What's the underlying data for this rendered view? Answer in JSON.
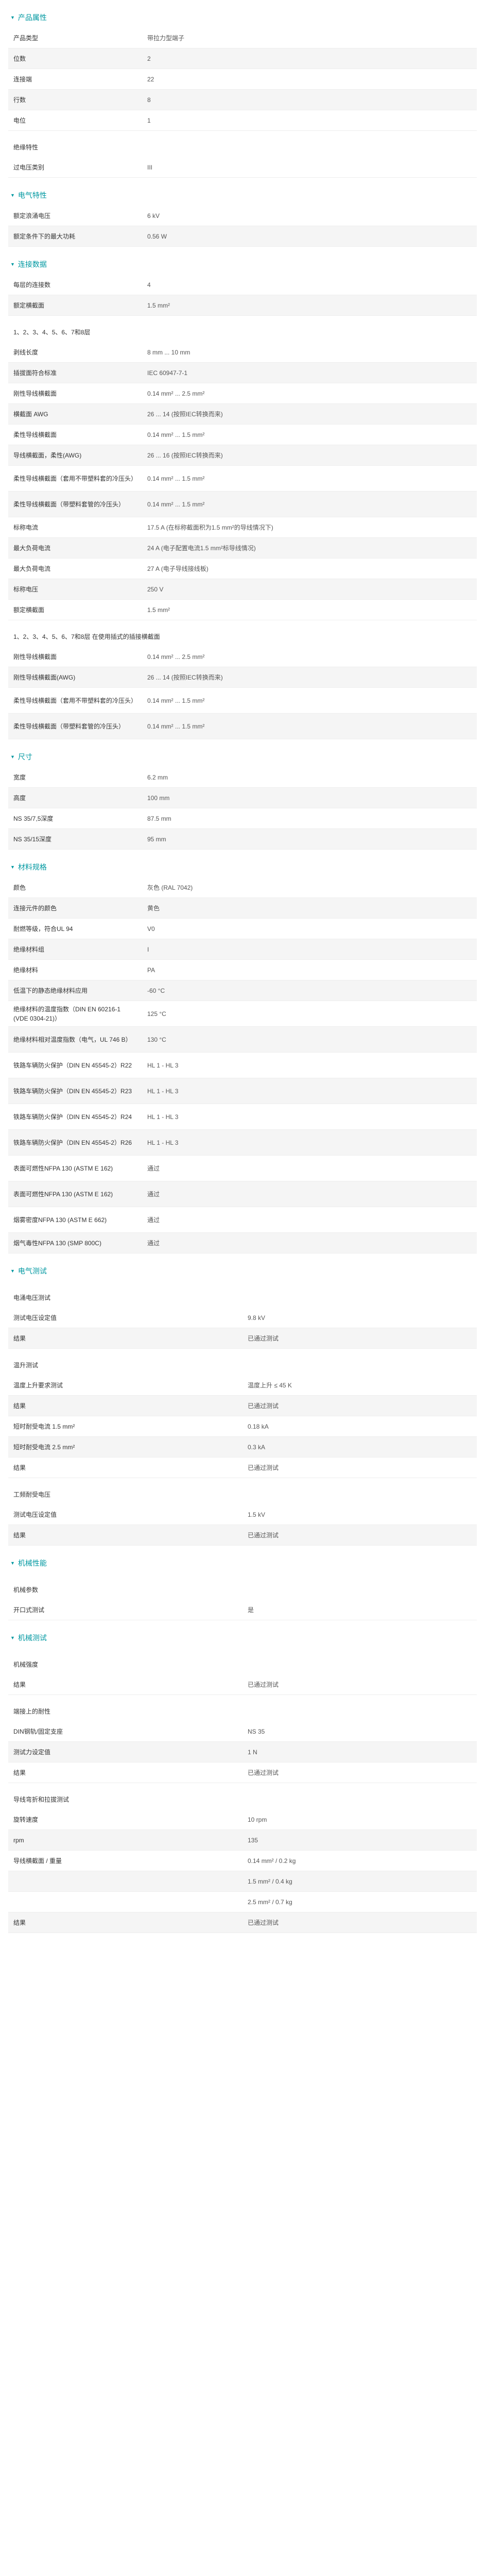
{
  "sections": [
    {
      "title": "产品属性",
      "rows": [
        {
          "k": "产品类型",
          "v": "带拉力型端子"
        },
        {
          "k": "位数",
          "v": "2"
        },
        {
          "k": "连接端",
          "v": "22"
        },
        {
          "k": "行数",
          "v": "8"
        },
        {
          "k": "电位",
          "v": "1"
        },
        {
          "sub": "绝缘特性"
        },
        {
          "k": "过电压类别",
          "v": "III"
        }
      ]
    },
    {
      "title": "电气特性",
      "rows": [
        {
          "k": "额定浪涌电压",
          "v": "6 kV"
        },
        {
          "k": "额定条件下的最大功耗",
          "v": "0.56 W"
        }
      ]
    },
    {
      "title": "连接数据",
      "rows": [
        {
          "k": "每层的连接数",
          "v": "4"
        },
        {
          "k": "额定横截面",
          "v": "1.5 mm²"
        },
        {
          "sub": "1、2、3、4、5、6、7和8层"
        },
        {
          "k": "剥线长度",
          "v": "8 mm ... 10 mm"
        },
        {
          "k": "插拔面符合标准",
          "v": "IEC 60947-7-1"
        },
        {
          "k": "刚性导线横截面",
          "v": "0.14 mm² ... 2.5 mm²"
        },
        {
          "k": "横截面 AWG",
          "v": "26 ... 14 (按照IEC转换而来)"
        },
        {
          "k": "柔性导线横截面",
          "v": "0.14 mm² ... 1.5 mm²"
        },
        {
          "k": "导线横截面，柔性(AWG)",
          "v": "26 ... 16 (按照IEC转换而来)"
        },
        {
          "k": "柔性导线横截面（套用不带塑料套的冷压头）",
          "v": "0.14 mm² ... 1.5 mm²",
          "h": "h49"
        },
        {
          "k": "柔性导线横截面（带塑料套管的冷压头）",
          "v": "0.14 mm² ... 1.5 mm²",
          "h": "h49"
        },
        {
          "k": "标称电流",
          "v": "17.5 A (在标称截面积为1.5 mm²的导线情况下)"
        },
        {
          "k": "最大负荷电流",
          "v": "24 A (电子配置电流1.5 mm²标导线情况)"
        },
        {
          "k": "最大负荷电流",
          "v": "27 A (电子导线接线板)"
        },
        {
          "k": "标称电压",
          "v": "250 V"
        },
        {
          "k": "额定横截面",
          "v": "1.5 mm²"
        },
        {
          "sub": "1、2、3、4、5、6、7和8层 在使用插式的插接横截面"
        },
        {
          "k": "刚性导线横截面",
          "v": "0.14 mm² ... 2.5 mm²"
        },
        {
          "k": "刚性导线横截面(AWG)",
          "v": "26 ... 14 (按照IEC转换而来)"
        },
        {
          "k": "柔性导线横截面（套用不带塑料套的冷压头）",
          "v": "0.14 mm² ... 1.5 mm²",
          "h": "h49"
        },
        {
          "k": "柔性导线横截面（带塑料套管的冷压头）",
          "v": "0.14 mm² ... 1.5 mm²",
          "h": "h49"
        }
      ]
    },
    {
      "title": "尺寸",
      "rows": [
        {
          "k": "宽度",
          "v": "6.2 mm"
        },
        {
          "k": "高度",
          "v": "100 mm"
        },
        {
          "k": "NS 35/7,5深度",
          "v": "87.5 mm"
        },
        {
          "k": "NS 35/15深度",
          "v": "95 mm"
        }
      ]
    },
    {
      "title": "材料规格",
      "rows": [
        {
          "k": "颜色",
          "v": "灰色 (RAL 7042)"
        },
        {
          "k": "连接元件的颜色",
          "v": "黄色"
        },
        {
          "k": "耐燃等级，符合UL 94",
          "v": "V0"
        },
        {
          "k": "绝缘材料组",
          "v": "I"
        },
        {
          "k": "绝缘材料",
          "v": "PA"
        },
        {
          "k": "低温下的静态绝缘材料应用",
          "v": "-60 °C"
        },
        {
          "k": "绝缘材料的温度指数（DIN EN 60216-1 (VDE 0304-21)）",
          "v": "125 °C",
          "h": "h49"
        },
        {
          "k": "绝缘材料相对温度指数（电气，UL 746 B）",
          "v": "130 °C",
          "h": "h49"
        },
        {
          "k": "铁路车辆防火保护（DIN EN 45545-2）R22",
          "v": "HL 1 - HL 3",
          "h": "h49"
        },
        {
          "k": "铁路车辆防火保护（DIN EN 45545-2）R23",
          "v": "HL 1 - HL 3",
          "h": "h49"
        },
        {
          "k": "铁路车辆防火保护（DIN EN 45545-2）R24",
          "v": "HL 1 - HL 3",
          "h": "h49"
        },
        {
          "k": "铁路车辆防火保护（DIN EN 45545-2）R26",
          "v": "HL 1 - HL 3",
          "h": "h49"
        },
        {
          "k": "表面可燃性NFPA 130 (ASTM E 162)",
          "v": "通过",
          "h": "h49"
        },
        {
          "k": "表面可燃性NFPA 130 (ASTM E 162)",
          "v": "通过",
          "h": "h49"
        },
        {
          "k": "烟雾密度NFPA 130 (ASTM E 662)",
          "v": "通过",
          "h": "h49"
        },
        {
          "k": "烟气毒性NFPA 130 (SMP 800C)",
          "v": "通过"
        }
      ]
    },
    {
      "title": "电气测试",
      "rows": [
        {
          "sub": "电涌电压测试"
        },
        {
          "k": "测试电压设定值",
          "v": "9.8 kV"
        },
        {
          "k": "结果",
          "v": "已通过测试"
        },
        {
          "sub": "温升测试"
        },
        {
          "k": "温度上升要求测试",
          "v": "温度上升 ≤ 45 K"
        },
        {
          "k": "结果",
          "v": "已通过测试"
        },
        {
          "k": "短时耐受电流 1.5 mm²",
          "v": "0.18 kA"
        },
        {
          "k": "短时耐受电流 2.5 mm²",
          "v": "0.3 kA"
        },
        {
          "k": "结果",
          "v": "已通过测试"
        },
        {
          "sub": "工频耐受电压"
        },
        {
          "k": "测试电压设定值",
          "v": "1.5 kV"
        },
        {
          "k": "结果",
          "v": "已通过测试"
        }
      ]
    },
    {
      "title": "机械性能",
      "rows": [
        {
          "sub": "机械参数"
        },
        {
          "k": "开口式测试",
          "v": "是"
        }
      ]
    },
    {
      "title": "机械测试",
      "rows": [
        {
          "sub": "机械强度"
        },
        {
          "k": "结果",
          "v": "已通过测试"
        },
        {
          "sub": "端接上的耐性"
        },
        {
          "k": "DIN钢轨/固定支座",
          "v": "NS 35"
        },
        {
          "k": "测试力设定值",
          "v": "1 N"
        },
        {
          "k": "结果",
          "v": "已通过测试"
        },
        {
          "sub": "导线弯折和拉拔测试"
        },
        {
          "k": "旋转速度",
          "v": "10 rpm"
        },
        {
          "k": "rpm",
          "v": "135"
        },
        {
          "k": "导线横截面 / 重量",
          "v": "0.14 mm² / 0.2 kg"
        },
        {
          "k": "",
          "v": "1.5 mm² / 0.4 kg"
        },
        {
          "k": "",
          "v": "2.5 mm² / 0.7 kg"
        },
        {
          "k": "结果",
          "v": "已通过测试"
        }
      ]
    }
  ]
}
